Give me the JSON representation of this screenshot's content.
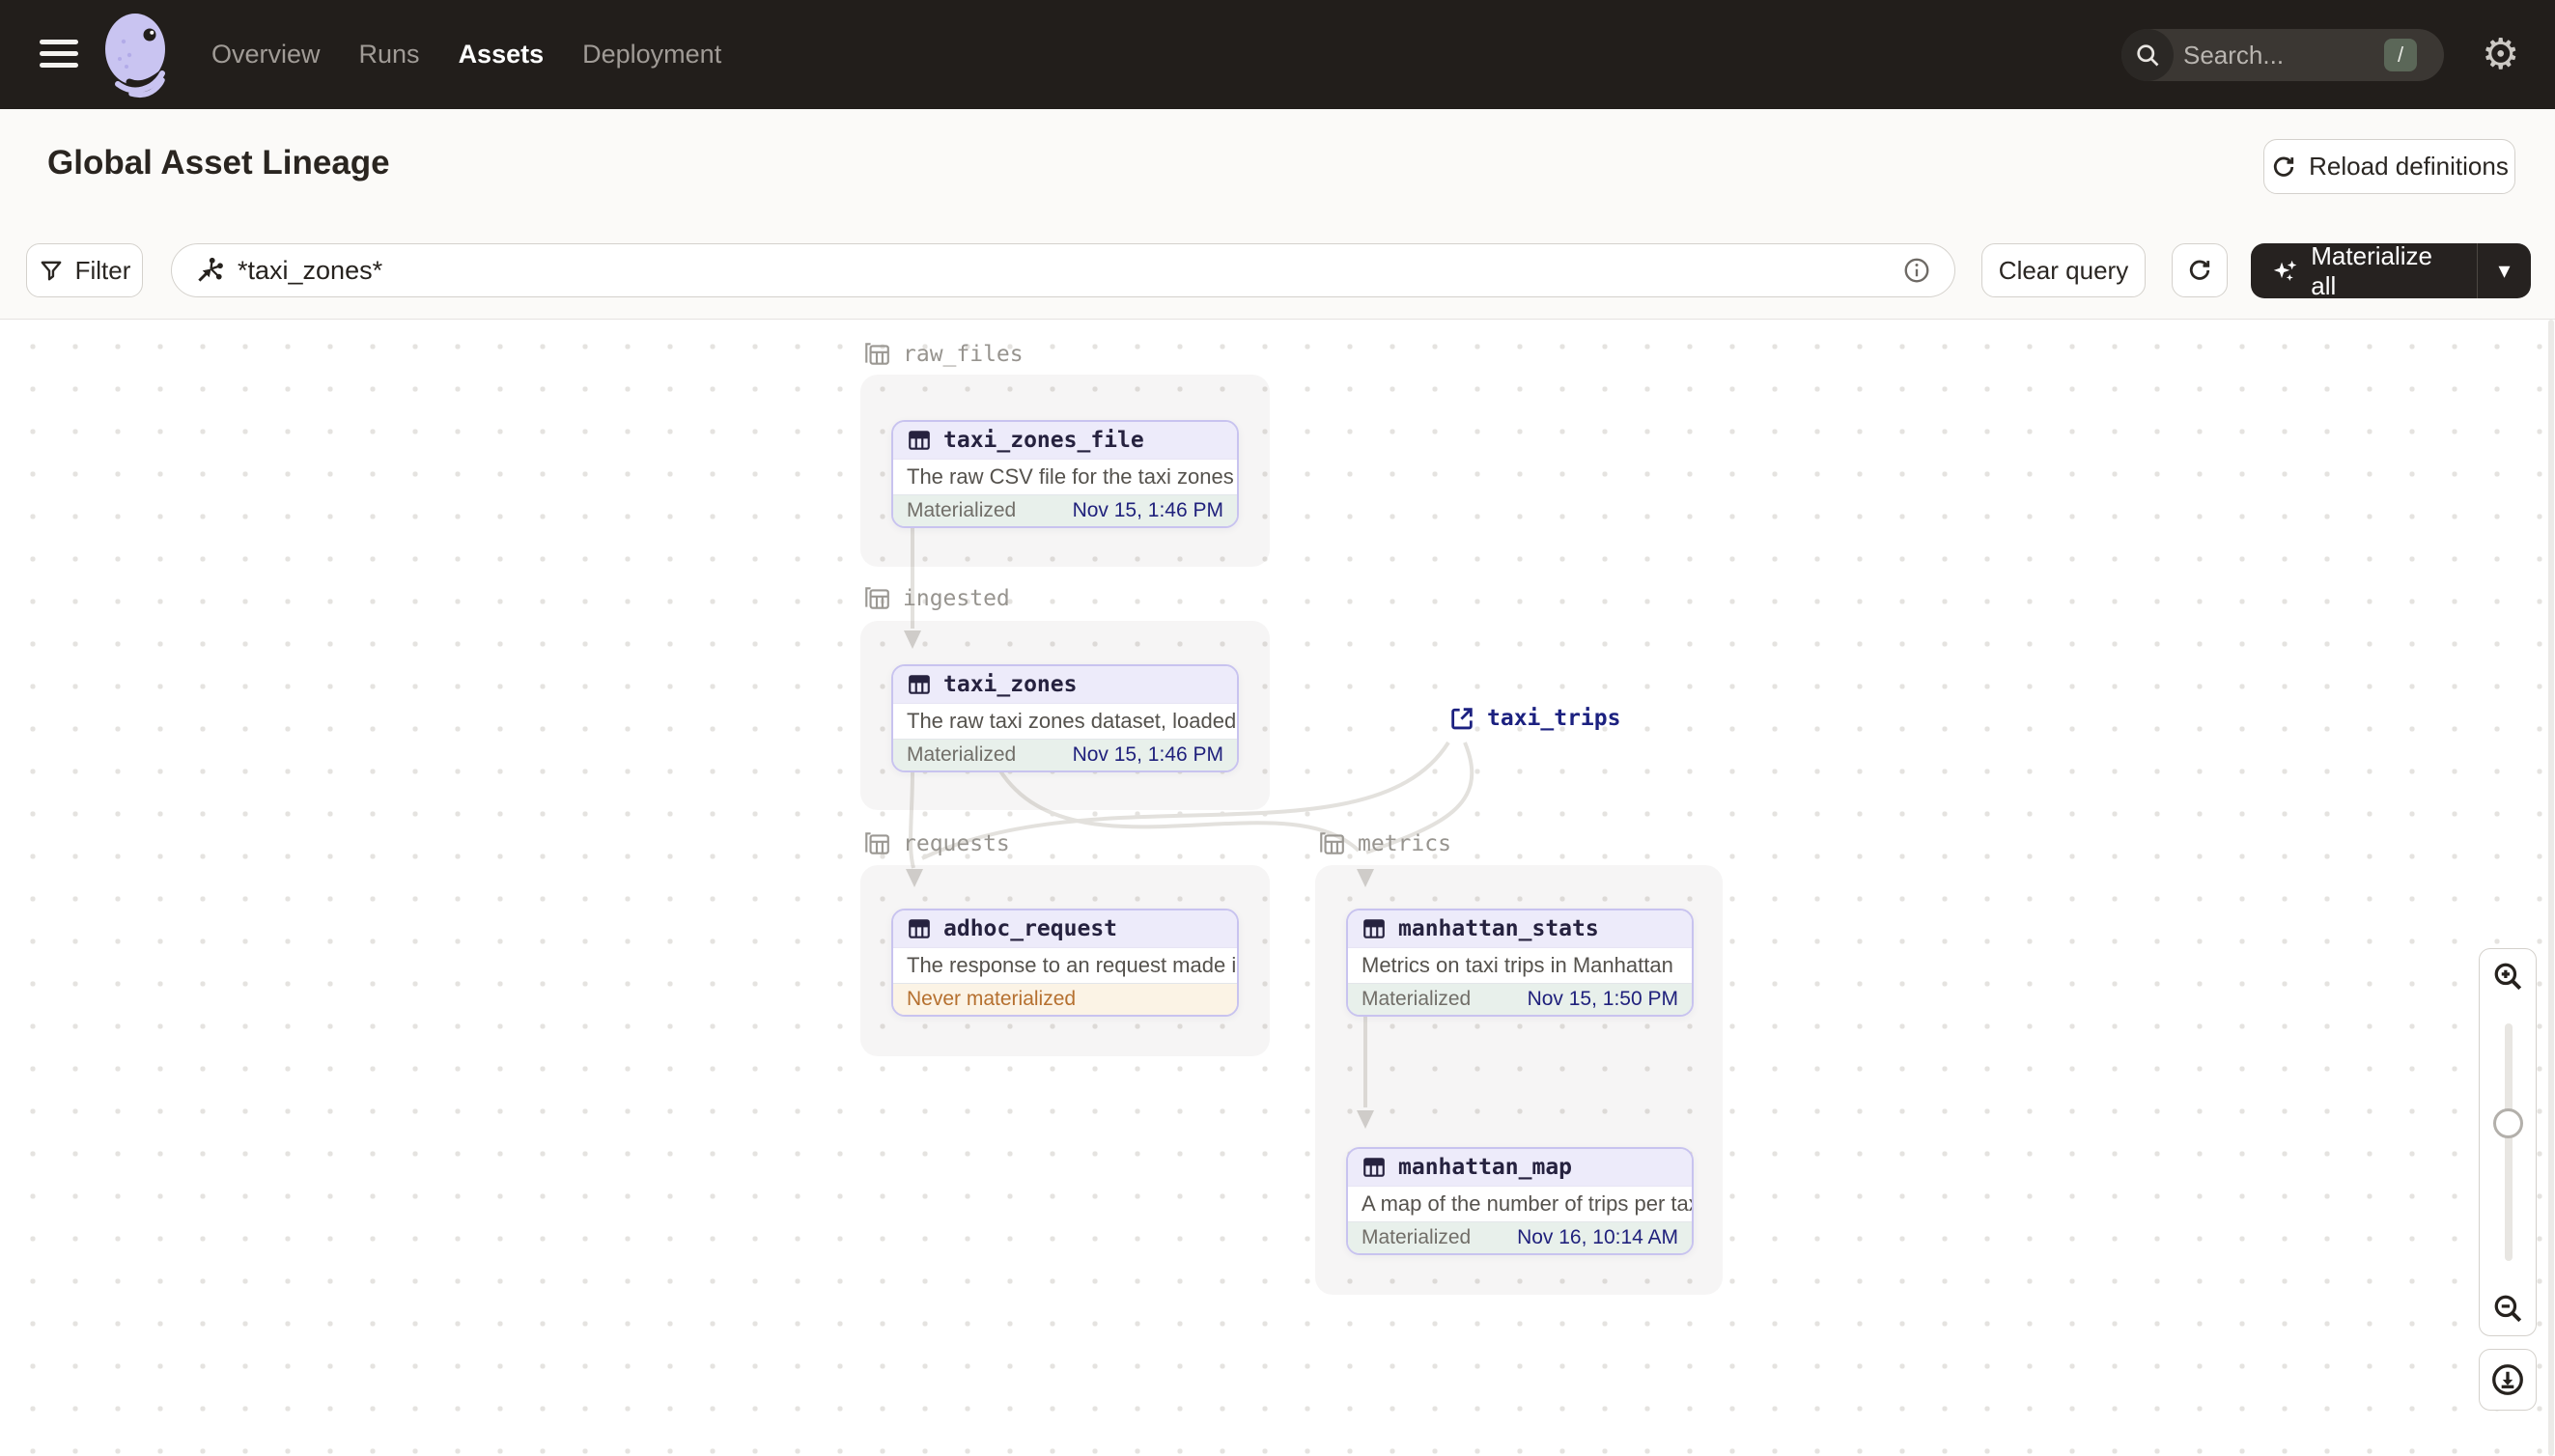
{
  "nav": {
    "items": [
      {
        "label": "Overview",
        "active": false
      },
      {
        "label": "Runs",
        "active": false
      },
      {
        "label": "Assets",
        "active": true
      },
      {
        "label": "Deployment",
        "active": false
      }
    ],
    "search": {
      "placeholder": "Search...",
      "shortcut": "/"
    }
  },
  "header": {
    "title": "Global Asset Lineage",
    "reload_button": "Reload definitions"
  },
  "toolbar": {
    "filter_button": "Filter",
    "query": {
      "value": "*taxi_zones*"
    },
    "clear_button": "Clear query",
    "materialize_button": "Materialize all"
  },
  "graph": {
    "groups": [
      {
        "name": "raw_files"
      },
      {
        "name": "ingested"
      },
      {
        "name": "requests"
      },
      {
        "name": "metrics"
      }
    ],
    "external_assets": [
      {
        "name": "taxi_trips"
      }
    ],
    "assets": [
      {
        "name": "taxi_zones_file",
        "description": "The raw CSV file for the taxi zones dat...",
        "status": "Materialized",
        "timestamp": "Nov 15, 1:46 PM",
        "group": "raw_files"
      },
      {
        "name": "taxi_zones",
        "description": "The raw taxi zones dataset, loaded int...",
        "status": "Materialized",
        "timestamp": "Nov 15, 1:46 PM",
        "group": "ingested"
      },
      {
        "name": "adhoc_request",
        "description": "The response to an request made in th...",
        "status": "Never materialized",
        "timestamp": "",
        "group": "requests"
      },
      {
        "name": "manhattan_stats",
        "description": "Metrics on taxi trips in Manhattan",
        "status": "Materialized",
        "timestamp": "Nov 15, 1:50 PM",
        "group": "metrics"
      },
      {
        "name": "manhattan_map",
        "description": "A map of the number of trips per taxi z...",
        "status": "Materialized",
        "timestamp": "Nov 16, 10:14 AM",
        "group": "metrics"
      }
    ]
  },
  "icons": {
    "settings": "⚙",
    "caret_down": "▾"
  },
  "colors": {
    "nav_bg": "#221e1b",
    "accent_lavender": "#c8c3ef",
    "node_header_bg": "#edebfa",
    "materialized_bg": "#e8f0eb",
    "never_materialized_bg": "#fbf3e5",
    "never_materialized_text": "#b5702f",
    "timestamp_navy": "#20217c",
    "external_asset_navy": "#1c2180",
    "edge_gray": "#e3e1dd"
  }
}
